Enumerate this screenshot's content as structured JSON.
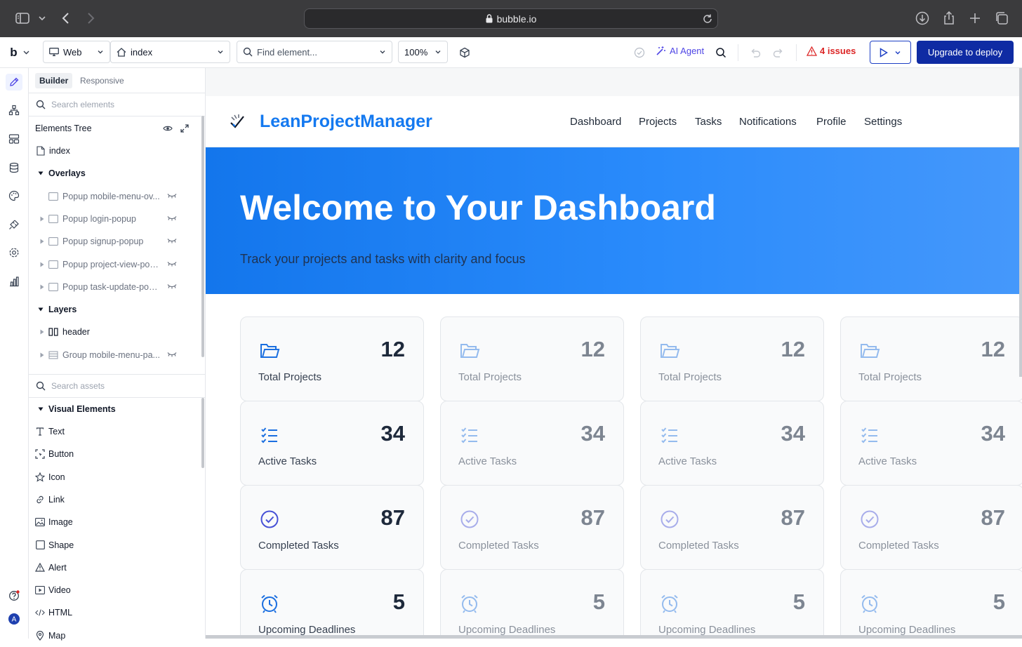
{
  "browser": {
    "url": "bubble.io"
  },
  "toolbar": {
    "logo": "b",
    "platform": "Web",
    "page": "index",
    "find_placeholder": "Find element...",
    "zoom": "100%",
    "ai_agent": "AI Agent",
    "issues": "4 issues",
    "deploy": "Upgrade to deploy"
  },
  "panel": {
    "tabs": [
      "Builder",
      "Responsive"
    ],
    "search_elements_placeholder": "Search elements",
    "tree_title": "Elements Tree",
    "tree": [
      {
        "label": "index",
        "icon": "page-icon",
        "caret": "",
        "level": 0
      },
      {
        "label": "Overlays",
        "icon": "",
        "caret": "down",
        "level": 0,
        "bold": true
      },
      {
        "label": "Popup mobile-menu-ov...",
        "icon": "popup-icon",
        "caret": "",
        "level": 1,
        "hidden": true
      },
      {
        "label": "Popup login-popup",
        "icon": "popup-icon",
        "caret": "right",
        "level": 1,
        "hidden": true
      },
      {
        "label": "Popup signup-popup",
        "icon": "popup-icon",
        "caret": "right",
        "level": 1,
        "hidden": true
      },
      {
        "label": "Popup project-view-pop...",
        "icon": "popup-icon",
        "caret": "right",
        "level": 1,
        "hidden": true
      },
      {
        "label": "Popup task-update-pop...",
        "icon": "popup-icon",
        "caret": "right",
        "level": 1,
        "hidden": true
      },
      {
        "label": "Layers",
        "icon": "",
        "caret": "down",
        "level": 0,
        "bold": true
      },
      {
        "label": "header",
        "icon": "columns-icon",
        "caret": "right",
        "level": 1
      },
      {
        "label": "Group mobile-menu-pa...",
        "icon": "rows-icon",
        "caret": "right",
        "level": 1,
        "hidden": true
      }
    ],
    "search_assets_placeholder": "Search assets",
    "visual_title": "Visual Elements",
    "visual": [
      {
        "label": "Text",
        "icon": "text-icon"
      },
      {
        "label": "Button",
        "icon": "button-icon"
      },
      {
        "label": "Icon",
        "icon": "star-icon"
      },
      {
        "label": "Link",
        "icon": "link-icon"
      },
      {
        "label": "Image",
        "icon": "image-icon"
      },
      {
        "label": "Shape",
        "icon": "shape-icon"
      },
      {
        "label": "Alert",
        "icon": "alert-icon"
      },
      {
        "label": "Video",
        "icon": "video-icon"
      },
      {
        "label": "HTML",
        "icon": "html-icon"
      },
      {
        "label": "Map",
        "icon": "map-icon"
      }
    ]
  },
  "site": {
    "brand": "LeanProjectManager",
    "nav": [
      "Dashboard",
      "Projects",
      "Tasks",
      "Notifications",
      "Profile",
      "Settings"
    ],
    "hero_title": "Welcome to Your Dashboard",
    "hero_subtitle": "Track your projects and tasks with clarity and focus",
    "stats": [
      {
        "value": "12",
        "label": "Total Projects",
        "icon": "folder-icon"
      },
      {
        "value": "34",
        "label": "Active Tasks",
        "icon": "checklist-icon"
      },
      {
        "value": "87",
        "label": "Completed Tasks",
        "icon": "check-circle-icon"
      },
      {
        "value": "5",
        "label": "Upcoming Deadlines",
        "icon": "alarm-icon"
      }
    ]
  },
  "colors": {
    "brand_blue": "#1479f0",
    "deploy_navy": "#0f2ba3",
    "issue_red": "#dc2626",
    "ai_purple": "#4f46e5"
  }
}
